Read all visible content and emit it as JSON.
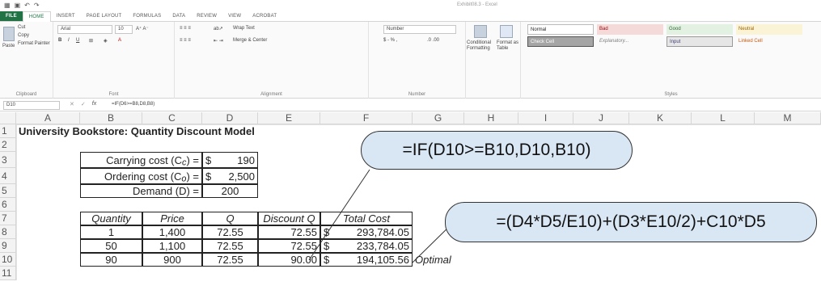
{
  "window": {
    "title": "Exhibit08.3 - Excel"
  },
  "ribbon": {
    "tabs": [
      "FILE",
      "HOME",
      "INSERT",
      "PAGE LAYOUT",
      "FORMULAS",
      "DATA",
      "REVIEW",
      "VIEW",
      "ACROBAT"
    ],
    "clipboard": {
      "paste": "Paste",
      "cut": "Cut",
      "copy": "Copy",
      "format_painter": "Format Painter",
      "label": "Clipboard"
    },
    "font": {
      "name": "Arial",
      "size": "10",
      "label": "Font"
    },
    "alignment": {
      "wrap": "Wrap Text",
      "merge": "Merge & Center",
      "label": "Alignment"
    },
    "number": {
      "format": "Number",
      "currency": "$ - % ,",
      "label": "Number"
    },
    "conditional": "Conditional Formatting",
    "format_table": "Format as Table",
    "styles": {
      "label": "Styles",
      "items": [
        "Normal",
        "Bad",
        "Good",
        "Neutral",
        "Check Cell",
        "Explanatory...",
        "Input",
        "Linked Cell"
      ]
    }
  },
  "formula_bar": {
    "cell": "D10",
    "formula": "=IF(D6>=B8,D8,B8)"
  },
  "columns": [
    "A",
    "B",
    "C",
    "D",
    "E",
    "F",
    "G",
    "H",
    "I",
    "J",
    "K",
    "L",
    "M"
  ],
  "rows": [
    "1",
    "2",
    "3",
    "4",
    "5",
    "6",
    "7",
    "8",
    "9",
    "10",
    "11"
  ],
  "sheet": {
    "title": "University Bookstore: Quantity Discount Model",
    "carrying_label": "Carrying cost (C",
    "carrying_sub": "c",
    "carrying_end": ") =",
    "carrying_cur": "$",
    "carrying_val": "190",
    "ordering_label": "Ordering cost (C",
    "ordering_sub": "o",
    "ordering_end": ") =",
    "ordering_cur": "$",
    "ordering_val": "2,500",
    "demand_label": "Demand (D) =",
    "demand_val": "200",
    "headers": [
      "Quantity",
      "Price",
      "Q",
      "Discount Q",
      "Total Cost"
    ],
    "data": [
      {
        "qty": "1",
        "price": "1,400",
        "q": "72.55",
        "dq": "72.55",
        "cur": "$",
        "cost": "293,784.05"
      },
      {
        "qty": "50",
        "price": "1,100",
        "q": "72.55",
        "dq": "72.55",
        "cur": "$",
        "cost": "233,784.05"
      },
      {
        "qty": "90",
        "price": "900",
        "q": "72.55",
        "dq": "90.00",
        "cur": "$",
        "cost": "194,105.56"
      }
    ],
    "optimal": "Optimal"
  },
  "callouts": {
    "discount_formula": "=IF(D10>=B10,D10,B10)",
    "cost_formula": "=(D4*D5/E10)+(D3*E10/2)+C10*D5"
  },
  "colors": {
    "file_tab": "#217346",
    "callout_fill": "#d9e6f4",
    "check_cell": "#a5a5a5"
  }
}
